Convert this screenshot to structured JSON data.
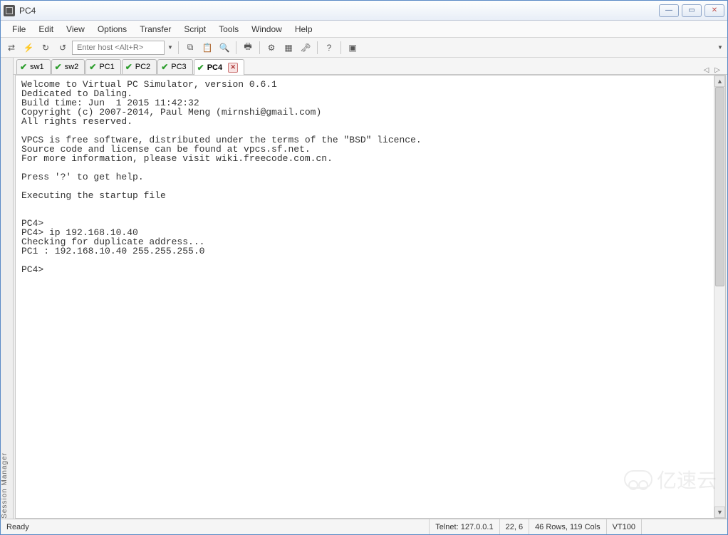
{
  "window": {
    "title": "PC4"
  },
  "menu": [
    "File",
    "Edit",
    "View",
    "Options",
    "Transfer",
    "Script",
    "Tools",
    "Window",
    "Help"
  ],
  "toolbar": {
    "host_placeholder": "Enter host <Alt+R>"
  },
  "side_tab": "Session Manager",
  "tabs": [
    {
      "label": "sw1",
      "active": false
    },
    {
      "label": "sw2",
      "active": false
    },
    {
      "label": "PC1",
      "active": false
    },
    {
      "label": "PC2",
      "active": false
    },
    {
      "label": "PC3",
      "active": false
    },
    {
      "label": "PC4",
      "active": true
    }
  ],
  "terminal": {
    "lines": [
      "Welcome to Virtual PC Simulator, version 0.6.1",
      "Dedicated to Daling.",
      "Build time: Jun  1 2015 11:42:32",
      "Copyright (c) 2007-2014, Paul Meng (mirnshi@gmail.com)",
      "All rights reserved.",
      "",
      "VPCS is free software, distributed under the terms of the \"BSD\" licence.",
      "Source code and license can be found at vpcs.sf.net.",
      "For more information, please visit wiki.freecode.com.cn.",
      "",
      "Press '?' to get help.",
      "",
      "Executing the startup file",
      "",
      "",
      "PC4>",
      "PC4> ip 192.168.10.40",
      "Checking for duplicate address...",
      "PC1 : 192.168.10.40 255.255.255.0",
      "",
      "PC4>"
    ]
  },
  "status": {
    "ready": "Ready",
    "conn": "Telnet: 127.0.0.1",
    "pos": "22,   6",
    "size": "46 Rows, 119 Cols",
    "emul": "VT100"
  },
  "watermark": "亿速云"
}
